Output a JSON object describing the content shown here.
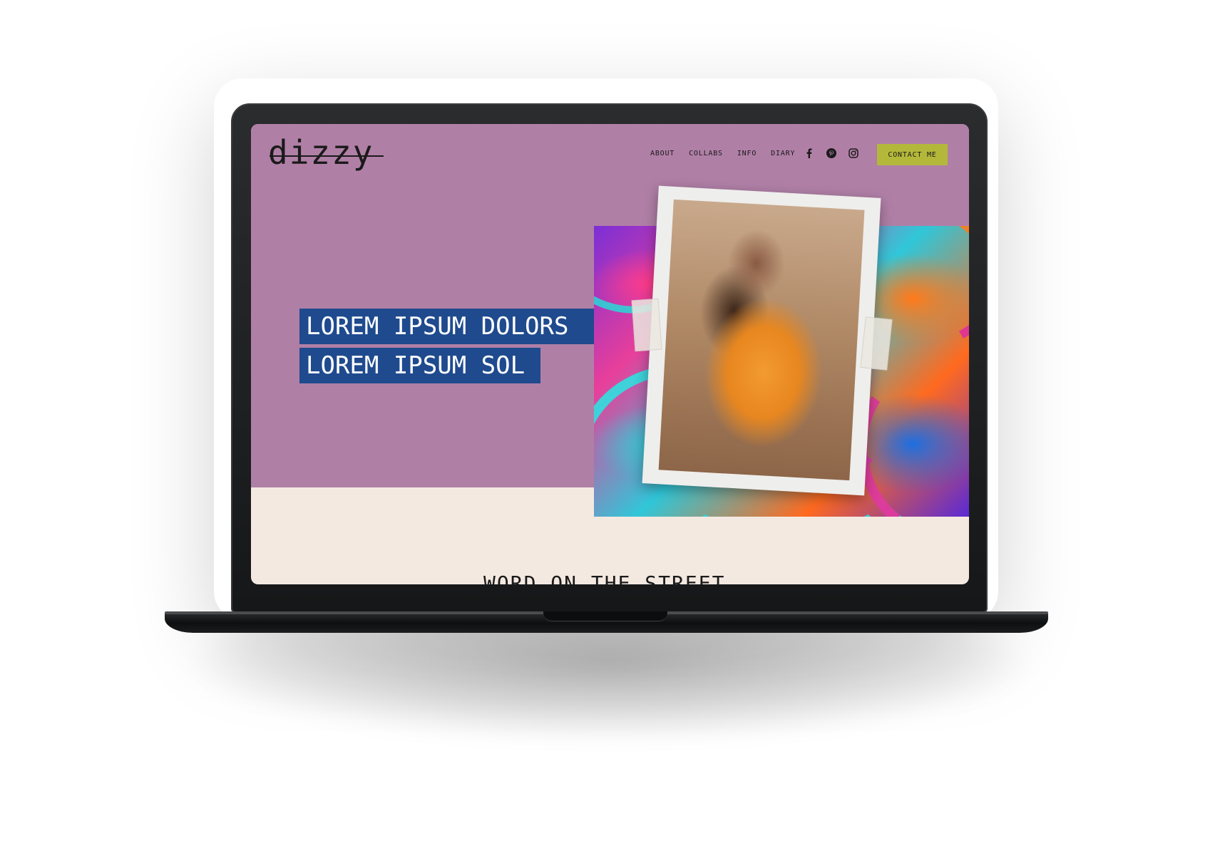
{
  "site": {
    "logo": "dizzy",
    "nav": {
      "about": "ABOUT",
      "collabs": "COLLABS",
      "info": "INFO",
      "diary": "DIARY"
    },
    "socials": [
      "facebook-icon",
      "pinterest-icon",
      "instagram-icon"
    ],
    "contact_label": "CONTACT ME"
  },
  "hero": {
    "line1": "LOREM IPSUM DOLORS",
    "line2": "LOREM IPSUM SOL"
  },
  "section": {
    "title": "WORD ON THE STREET"
  },
  "colors": {
    "hero_bg": "#b07fa6",
    "page_bg": "#f4e9e1",
    "headline_bg": "#1f4a8e",
    "contact_bg": "#b4b83a"
  }
}
